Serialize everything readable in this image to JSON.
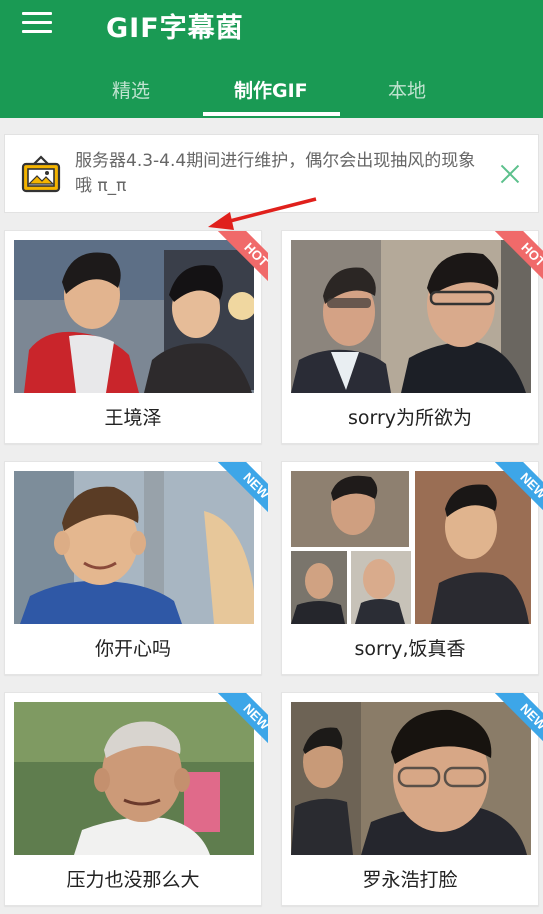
{
  "app": {
    "title": "GIF字幕菌"
  },
  "tabs": [
    {
      "label": "精选"
    },
    {
      "label": "制作GIF"
    },
    {
      "label": "本地"
    }
  ],
  "active_tab": "制作GIF",
  "notice": {
    "text": "服务器4.3-4.4期间进行维护，偶尔会出现抽风的现象哦 π_π"
  },
  "cards": [
    {
      "caption": "王境泽",
      "badge": "HOT"
    },
    {
      "caption": "sorry为所欲为",
      "badge": "HOT"
    },
    {
      "caption": "你开心吗",
      "badge": "NEW"
    },
    {
      "caption": "sorry,饭真香",
      "badge": "NEW"
    },
    {
      "caption": "压力也没那么大",
      "badge": "NEW"
    },
    {
      "caption": "罗永浩打脸",
      "badge": "NEW"
    }
  ],
  "colors": {
    "header": "#1a9a54",
    "hot_badge": "#f06a6a",
    "new_badge": "#3da6e8",
    "arrow": "#e0201c"
  },
  "icons": {
    "menu": "hamburger-icon",
    "notice": "image-frame-icon",
    "close": "close-icon"
  }
}
